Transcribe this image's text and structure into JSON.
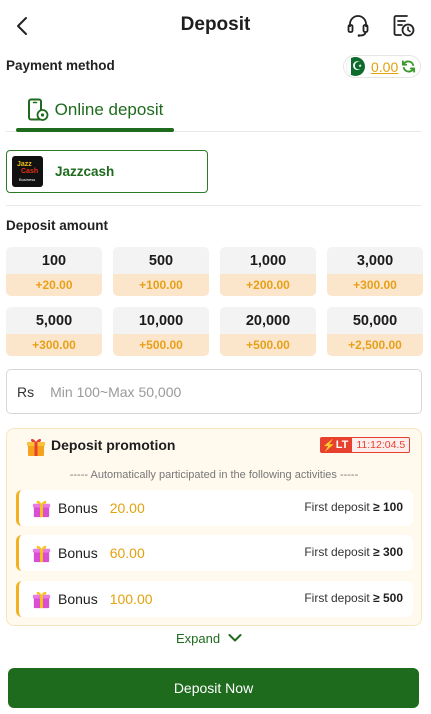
{
  "header": {
    "title": "Deposit",
    "back_icon": "chevron-left-icon",
    "support_icon": "headset-icon",
    "history_icon": "document-clock-icon"
  },
  "payment": {
    "label": "Payment method",
    "balance": "0.00",
    "flag_icon": "pakistan-flag-icon",
    "refresh_icon": "refresh-icon"
  },
  "tabs": [
    {
      "label": "Online deposit",
      "icon": "phone-deposit-icon",
      "active": true
    }
  ],
  "methods": [
    {
      "name": "Jazzcash",
      "logo_text": [
        "Jazz",
        "Cash",
        "Business"
      ],
      "selected": true
    }
  ],
  "deposit_amount": {
    "label": "Deposit amount",
    "options": [
      {
        "amount": "100",
        "bonus": "+20.00"
      },
      {
        "amount": "500",
        "bonus": "+100.00"
      },
      {
        "amount": "1,000",
        "bonus": "+200.00"
      },
      {
        "amount": "3,000",
        "bonus": "+300.00"
      },
      {
        "amount": "5,000",
        "bonus": "+300.00"
      },
      {
        "amount": "10,000",
        "bonus": "+500.00"
      },
      {
        "amount": "20,000",
        "bonus": "+500.00"
      },
      {
        "amount": "50,000",
        "bonus": "+2,500.00"
      }
    ]
  },
  "amount_input": {
    "currency": "Rs",
    "placeholder": "Min 100~Max 50,000",
    "value": ""
  },
  "promotion": {
    "title": "Deposit promotion",
    "badge": "LT",
    "timer": "11:12:04.5",
    "note": "----- Automatically participated in the following activities -----",
    "items": [
      {
        "label": "Bonus",
        "amount": "20.00",
        "condition": "First deposit",
        "threshold": "≥ 100"
      },
      {
        "label": "Bonus",
        "amount": "60.00",
        "condition": "First deposit",
        "threshold": "≥ 300"
      },
      {
        "label": "Bonus",
        "amount": "100.00",
        "condition": "First deposit",
        "threshold": "≥ 500"
      }
    ]
  },
  "expand": {
    "label": "Expand"
  },
  "submit": {
    "label": "Deposit Now"
  },
  "colors": {
    "primary_green": "#1e6b1e",
    "accent_orange": "#e3a10c",
    "bonus_bg": "#fbe6cc",
    "promo_bg": "#fff9ee",
    "timer_red": "#e8402f"
  }
}
